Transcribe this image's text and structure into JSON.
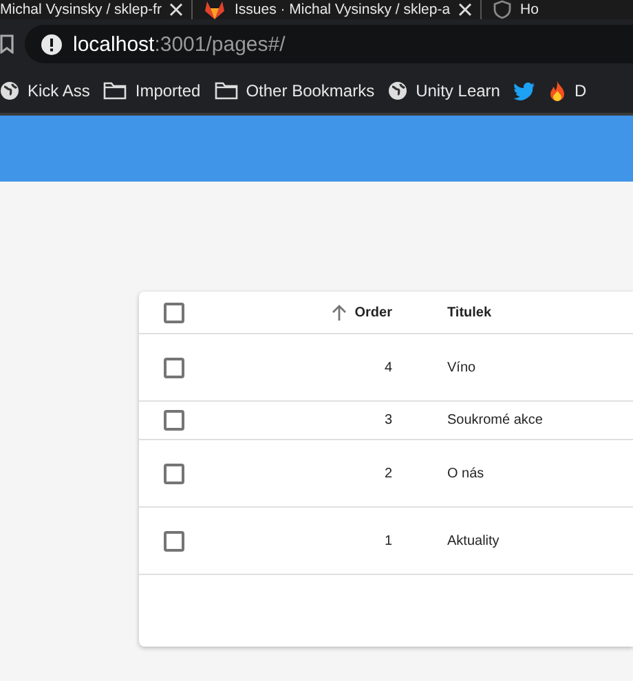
{
  "browser": {
    "tabs": [
      {
        "title": "Michal Vysinsky / sklep-fr"
      },
      {
        "title": "Issues · Michal Vysinsky / sklep-a"
      },
      {
        "title": "Ho"
      }
    ],
    "address": {
      "host": "localhost",
      "path": ":3001/pages#/"
    },
    "bookmarks": [
      {
        "label": "Kick Ass",
        "kind": "globe"
      },
      {
        "label": "Imported",
        "kind": "folder"
      },
      {
        "label": "Other Bookmarks",
        "kind": "folder"
      },
      {
        "label": "Unity Learn",
        "kind": "globe"
      },
      {
        "kind": "bird"
      },
      {
        "label": "D",
        "kind": "fire"
      }
    ]
  },
  "table": {
    "columns": [
      {
        "label": "Order",
        "sorted": true
      },
      {
        "label": "Titulek"
      }
    ],
    "header_checked": false,
    "rows": [
      {
        "order": "4",
        "title": "Víno",
        "checked": false
      },
      {
        "order": "3",
        "title": "Soukromé akce",
        "checked": false
      },
      {
        "order": "2",
        "title": "O nás",
        "checked": false
      },
      {
        "order": "1",
        "title": "Aktuality",
        "checked": false
      }
    ]
  }
}
